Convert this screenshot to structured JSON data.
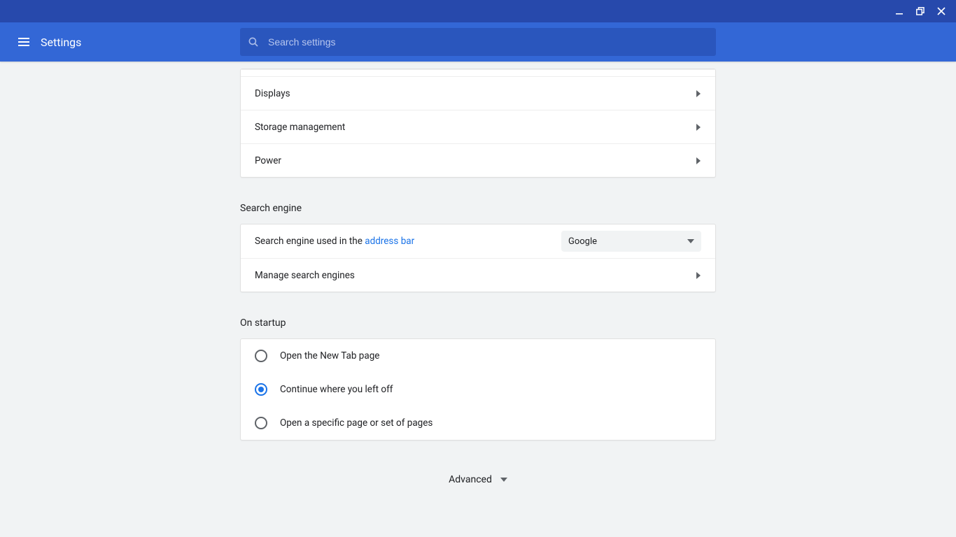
{
  "window": {
    "title": "Settings"
  },
  "search": {
    "placeholder": "Search settings"
  },
  "device_section": {
    "displays": "Displays",
    "storage": "Storage management",
    "power": "Power"
  },
  "search_engine_section": {
    "title": "Search engine",
    "row_prefix": "Search engine used in the ",
    "row_link": "address bar",
    "selected": "Google",
    "manage": "Manage search engines"
  },
  "startup_section": {
    "title": "On startup",
    "opt_newtab": "Open the New Tab page",
    "opt_continue": "Continue where you left off",
    "opt_specific": "Open a specific page or set of pages",
    "selected_index": 1
  },
  "advanced_label": "Advanced"
}
